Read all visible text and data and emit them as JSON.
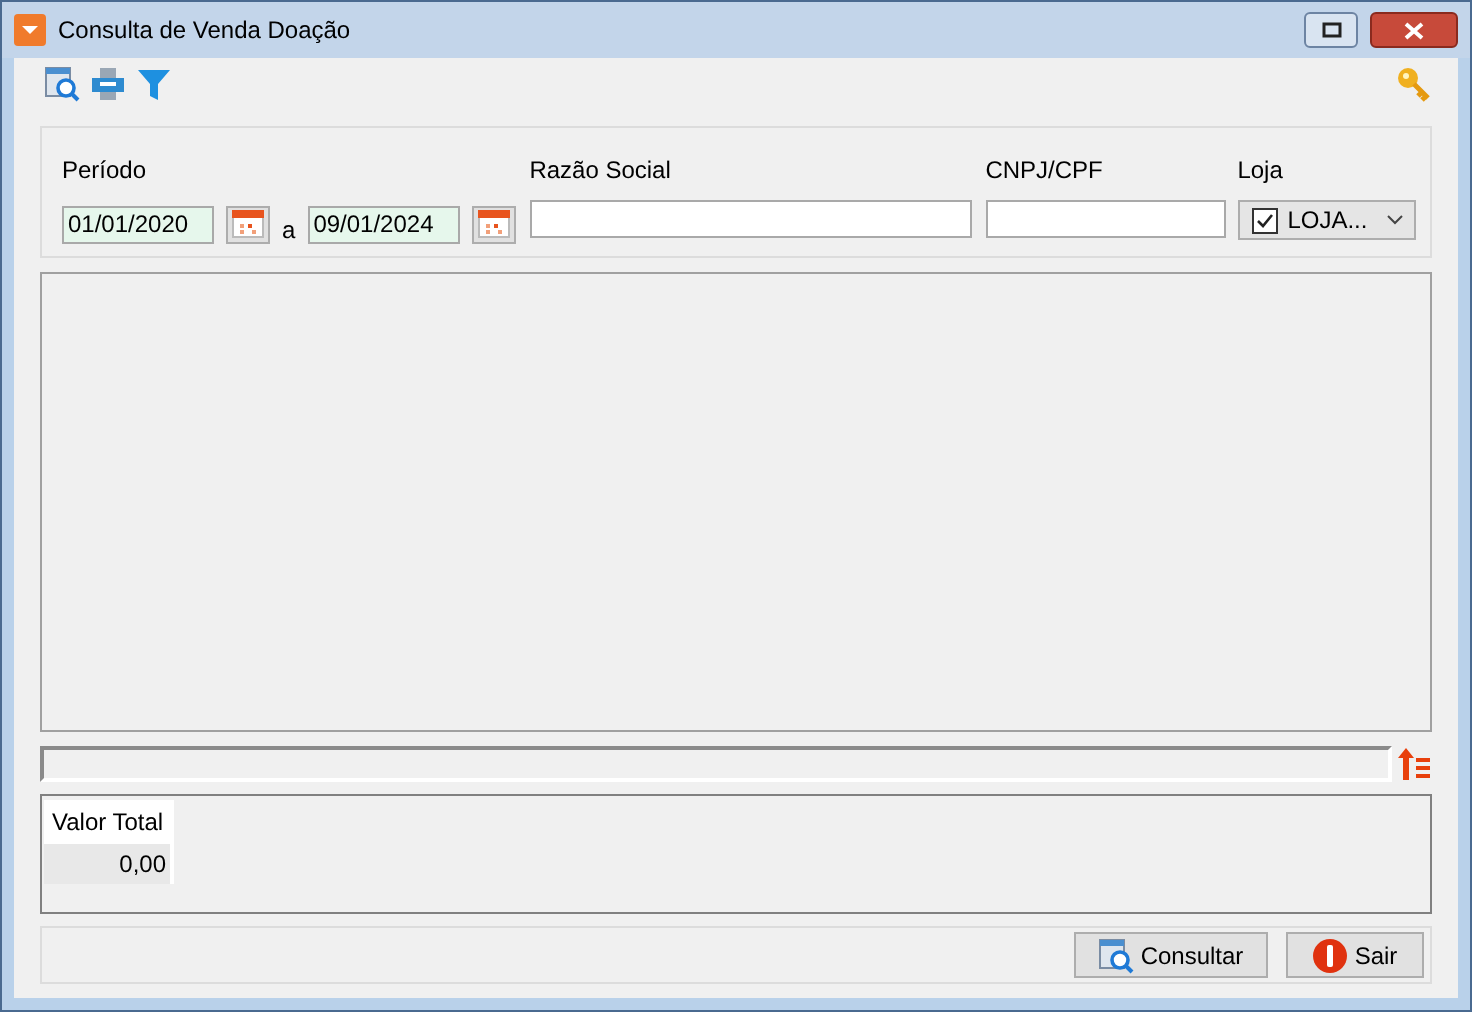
{
  "window": {
    "title": "Consulta de Venda Doação"
  },
  "filters": {
    "periodo": {
      "label": "Período",
      "from": "01/01/2020",
      "separator": "a",
      "to": "09/01/2024"
    },
    "razao_social": {
      "label": "Razão Social"
    },
    "cnpj_cpf": {
      "label": "CNPJ/CPF"
    },
    "loja": {
      "label": "Loja",
      "checked": true,
      "value": "LOJA..."
    }
  },
  "totals": {
    "label": "Valor Total",
    "value": "0,00"
  },
  "buttons": [
    {
      "kind": "search",
      "label": "Consultar"
    },
    {
      "kind": "exit",
      "label": "Sair"
    }
  ]
}
